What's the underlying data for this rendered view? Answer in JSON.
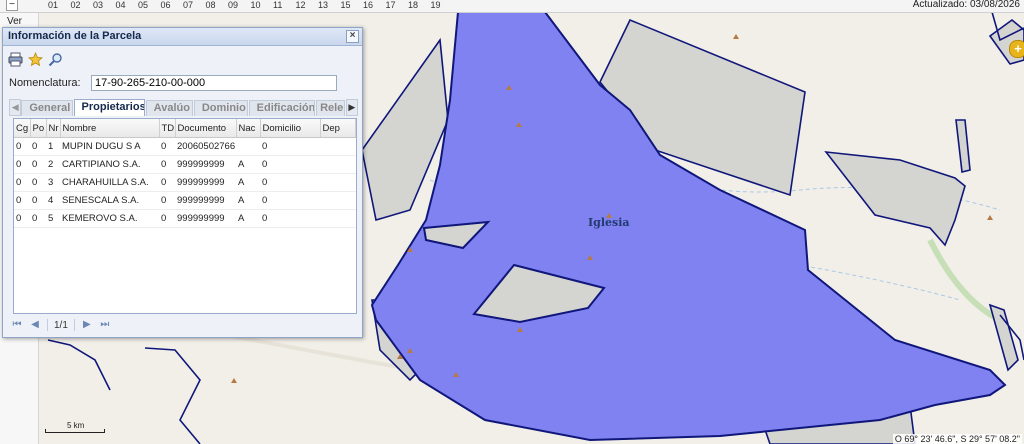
{
  "topbar": {
    "minus": "−",
    "days": [
      "01",
      "02",
      "03",
      "04",
      "05",
      "06",
      "07",
      "08",
      "09",
      "10",
      "11",
      "12",
      "13",
      "15",
      "16",
      "17",
      "18",
      "19"
    ],
    "updated": "Actualizado: 03/08/2026"
  },
  "left": {
    "ver": "Ver"
  },
  "map": {
    "place_label": "Iglesia",
    "scale_label": "5 km",
    "coords": "O 69° 23' 46.6\", S 29° 57' 08.2\"",
    "colors": {
      "selected_fill": "#7f82f0",
      "outline": "#10177a",
      "parcel_fill": "#d4d4d0",
      "background": "#f2efe9",
      "peak": "#b87a44"
    }
  },
  "panel": {
    "title": "Información de la Parcela",
    "close": "×",
    "nomenclatura_label": "Nomenclatura:",
    "nomenclatura_value": "17-90-265-210-00-000",
    "tabs": [
      "General",
      "Propietarios",
      "Avalúo",
      "Dominio",
      "Edificación",
      "Rele"
    ],
    "active_tab": "Propietarios",
    "columns": [
      "Cg",
      "Po",
      "Nr",
      "Nombre",
      "TD",
      "Documento",
      "Nac",
      "Domicilio",
      "Dep"
    ],
    "rows": [
      [
        "0",
        "0",
        "1",
        "MUPIN DUGU S A",
        "0",
        "20060502766",
        "",
        "0",
        ""
      ],
      [
        "0",
        "0",
        "2",
        "CARTIPIANO S.A.",
        "0",
        "999999999",
        "A",
        "0",
        ""
      ],
      [
        "0",
        "0",
        "3",
        "CHARAHUILLA S.A.",
        "0",
        "999999999",
        "A",
        "0",
        ""
      ],
      [
        "0",
        "0",
        "4",
        "SENESCALA S.A.",
        "0",
        "999999999",
        "A",
        "0",
        ""
      ],
      [
        "0",
        "0",
        "5",
        "KEMEROVO S.A.",
        "0",
        "999999999",
        "A",
        "0",
        ""
      ]
    ],
    "pager_text": "1/1"
  }
}
